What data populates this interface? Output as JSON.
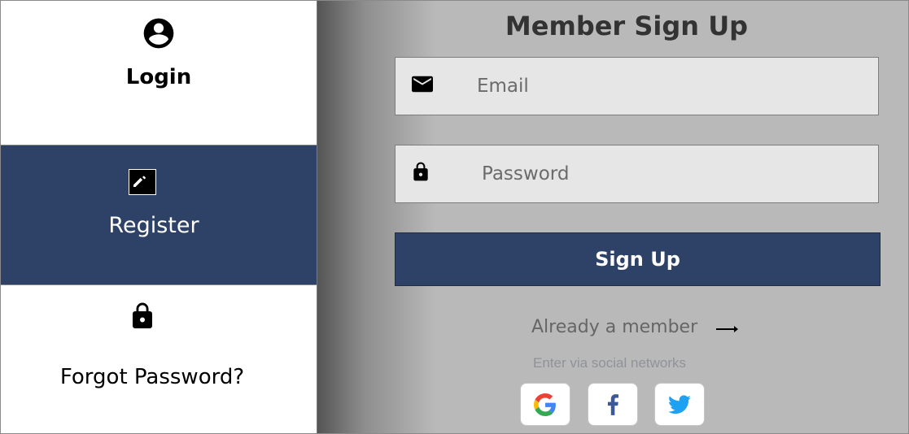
{
  "sidebar": {
    "login": {
      "label": "Login",
      "icon": "account-circle-icon"
    },
    "register": {
      "label": "Register",
      "icon": "edit-pencil-icon",
      "background": "#2e4166"
    },
    "forgot": {
      "label": "Forgot Password?",
      "icon": "lock-icon"
    }
  },
  "main": {
    "title": "Member Sign Up",
    "email": {
      "placeholder": "Email",
      "value": "",
      "icon": "mail-icon"
    },
    "password": {
      "placeholder": "Password",
      "value": "",
      "icon": "lock-icon"
    },
    "signup_label": "Sign Up",
    "already_member": "Already a member",
    "social_text": "Enter via social networks",
    "social": [
      {
        "name": "google",
        "icon": "google-icon"
      },
      {
        "name": "facebook",
        "icon": "facebook-icon"
      },
      {
        "name": "twitter",
        "icon": "twitter-icon"
      }
    ],
    "accent": "#2e4166"
  }
}
